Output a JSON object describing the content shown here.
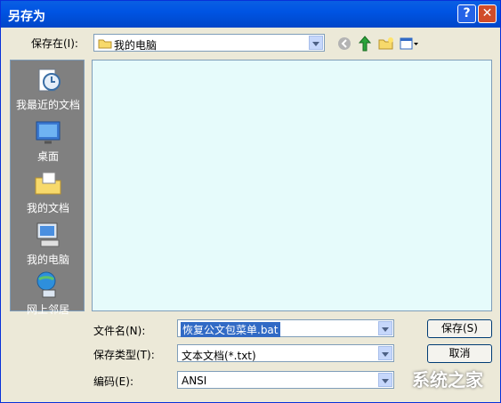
{
  "window": {
    "title": "另存为"
  },
  "top": {
    "save_in_label": "保存在(I):",
    "location": "我的电脑"
  },
  "places": [
    {
      "label": "我最近的文档",
      "icon": "recent-docs-icon"
    },
    {
      "label": "桌面",
      "icon": "desktop-icon"
    },
    {
      "label": "我的文档",
      "icon": "my-documents-icon"
    },
    {
      "label": "我的电脑",
      "icon": "my-computer-icon"
    },
    {
      "label": "网上邻居",
      "icon": "network-places-icon"
    }
  ],
  "form": {
    "filename_label": "文件名(N):",
    "filename_value": "恢复公文包菜单.bat",
    "filetype_label": "保存类型(T):",
    "filetype_value": "文本文档(*.txt)",
    "encoding_label": "编码(E):",
    "encoding_value": "ANSI",
    "save_button": "保存(S)",
    "cancel_button": "取消"
  },
  "watermark": {
    "text": "系统之家"
  }
}
